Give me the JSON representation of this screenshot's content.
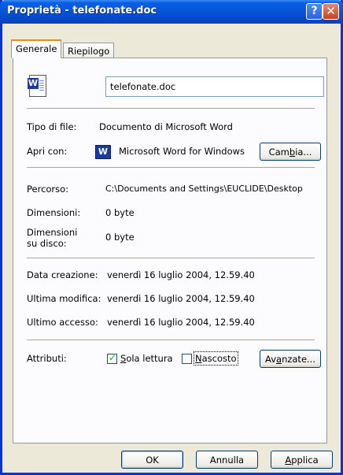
{
  "window": {
    "title": "Proprietà - telefonate.doc",
    "help_glyph": "?",
    "close_glyph": "✕"
  },
  "tabs": [
    {
      "label": "Generale",
      "active": true
    },
    {
      "label": "Riepilogo",
      "active": false
    }
  ],
  "general": {
    "file_name": "telefonate.doc",
    "file_type_label": "Tipo di file:",
    "file_type_value": "Documento di Microsoft Word",
    "open_with_label": "Apri con:",
    "open_with_value": "Microsoft Word for Windows",
    "change_button": {
      "pre": "Cam",
      "key": "b",
      "post": "ia..."
    },
    "location_label": "Percorso:",
    "location_value": "C:\\Documents and Settings\\EUCLIDE\\Desktop",
    "size_label": "Dimensioni:",
    "size_value": "0 byte",
    "size_on_disk_label": "Dimensioni su disco:",
    "size_on_disk_value": "0 byte",
    "created_label": "Data creazione:",
    "created_value": "venerdì 16 luglio 2004, 12.59.40",
    "modified_label": "Ultima modifica:",
    "modified_value": "venerdì 16 luglio 2004, 12.59.40",
    "accessed_label": "Ultimo accesso:",
    "accessed_value": "venerdì 16 luglio 2004, 12.59.40",
    "attributes_label": "Attributi:",
    "readonly": {
      "key": "S",
      "rest": "ola lettura",
      "checked": true
    },
    "hidden": {
      "key": "N",
      "rest": "ascosto",
      "checked": false
    },
    "advanced_button": {
      "pre": "Av",
      "key": "a",
      "post": "nzate..."
    }
  },
  "footer": {
    "ok_label": "OK",
    "cancel_label": "Annulla",
    "apply": {
      "key": "A",
      "rest": "pplica"
    }
  }
}
